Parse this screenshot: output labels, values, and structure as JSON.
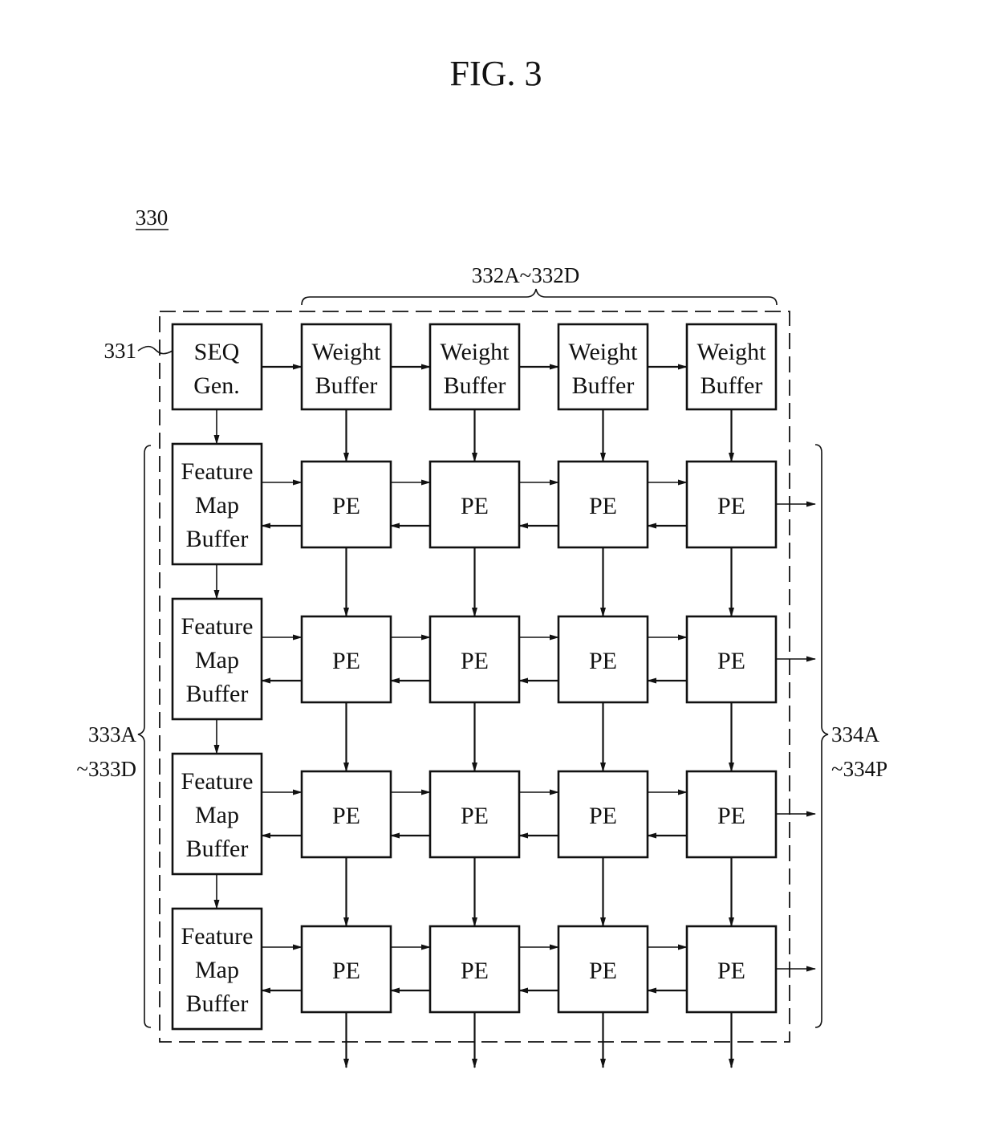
{
  "figure": {
    "title": "FIG. 3",
    "reference_number": "330"
  },
  "labels": {
    "seq_ref": "331",
    "weight_group_ref": "332A~332D",
    "feature_group_ref_line1": "333A",
    "feature_group_ref_line2": "~333D",
    "pe_group_ref_line1": "334A",
    "pe_group_ref_line2": "~334P"
  },
  "blocks": {
    "seq_gen": {
      "line1": "SEQ",
      "line2": "Gen."
    },
    "weight_buffers": [
      {
        "line1": "Weight",
        "line2": "Buffer"
      },
      {
        "line1": "Weight",
        "line2": "Buffer"
      },
      {
        "line1": "Weight",
        "line2": "Buffer"
      },
      {
        "line1": "Weight",
        "line2": "Buffer"
      }
    ],
    "feature_map_buffers": [
      {
        "line1": "Feature",
        "line2": "Map",
        "line3": "Buffer"
      },
      {
        "line1": "Feature",
        "line2": "Map",
        "line3": "Buffer"
      },
      {
        "line1": "Feature",
        "line2": "Map",
        "line3": "Buffer"
      },
      {
        "line1": "Feature",
        "line2": "Map",
        "line3": "Buffer"
      }
    ],
    "pe_grid": {
      "rows": 4,
      "cols": 4,
      "label": "PE"
    }
  }
}
